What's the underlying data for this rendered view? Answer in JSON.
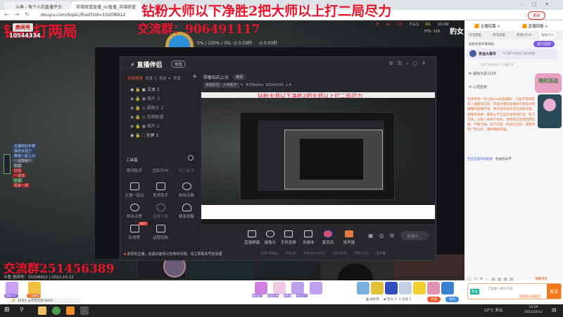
{
  "browser": {
    "tabs": [
      "斗鱼 - 每个人的直播平台",
      "英雄联盟直播_lol直播_英雄联盟"
    ],
    "url": "douyu.com/topic/lhsd?rid=10208912",
    "update_label": "更新"
  },
  "overlay": {
    "banner": "钻粉大师以下净胜2把大师以上打二局尽力",
    "group_top": "交流群：906491117",
    "left_text": "钻粉打两局",
    "room_badge": "房间号",
    "room_id": "10544334",
    "group_bottom": "交流群251456389",
    "room_info": "斗鱼 房间号：10208912 | 2022.10.12",
    "watermark": "豹女"
  },
  "hud": {
    "stats": "0% / 100% / 0%",
    "cd1": "0.59秒",
    "cd2": "0.00秒",
    "score": "8 vs 10",
    "kda": "7/1/1",
    "cs": "81",
    "time": "10:09",
    "fps": "FPS: 158"
  },
  "streamer_app": {
    "logo": "直播伴侣",
    "badge": "体验",
    "scene_tabs": [
      "常用场景",
      "场景 3",
      "场景 4",
      "场景"
    ],
    "sources": [
      "文本 1",
      "图片 3",
      "摄像头 2",
      "英雄联盟",
      "图片 2",
      "全屏 1"
    ],
    "title": "带着钻石上分",
    "edit_label": "修改",
    "category": "英雄联盟 · 大神教学",
    "nickname": "冰华Bekko",
    "room": "10544334",
    "fans": "4",
    "toolbox_title": "工具箱",
    "tool_row1": [
      "歌词助手",
      "全民乐PK",
      "大力金币"
    ],
    "tools": [
      "主播一起玩",
      "发货助手",
      "粉丝点歌",
      "粉丝点赞",
      "投屏下载",
      "健康提醒",
      "礼物秀",
      "远程控制"
    ],
    "hot_badge": "HOT",
    "notice": "亲爱的主播，如遇设备报公告到的问题，请立即联系号前说服",
    "bottom_buttons": [
      "直播屏幕",
      "摄像头",
      "手机投屏",
      "多媒体",
      "麦克风",
      "扬声器"
    ],
    "start_label": "直播中...",
    "status": [
      "码率:5Mb/s",
      "FPS:60",
      "丢帧:0(0.00%)",
      "CPU:44%",
      "内存:57%",
      "未开播"
    ]
  },
  "sidebar": {
    "links": [
      "主播招募 >",
      "直播回看 >"
    ],
    "tabs": [
      "日活跃度",
      "周活跃度",
      "贵宾(914)",
      "钻粉(53)"
    ],
    "rank_title": "钻粉享受专属特权",
    "join_label": "成为钻粉",
    "event_title": "幸运大事件",
    "event_text": "今日第1位粉丝已成为钻粉",
    "hint": "斗鱼严禁未成年人大额打赏",
    "items": [
      "超级元素1028",
      "心愿签到"
    ],
    "notice": "欢迎来到一爷之猫ovo的直播间。斗鱼严禁未成年人直播或打赏，欢迎主播在直播间内营造绿色健康的直播环境。请勿发布任何违法违规内容，请理性消费，警惕以不正当方式诱导打赏、私下交易，以防人身财产损失。请勿轻信各类招聘征婚、代练代抽、私下交易、购买礼包码、游戏币等广告信息，谨防网络诈骗。",
    "last_msg": "百合花盛开的如意",
    "last_msg2": "豹女的头不",
    "promo": "限时活动"
  },
  "chat_input": {
    "placeholder": "这里输入聊天内容",
    "send": "发送",
    "badge": "粉丝",
    "mode": "弹幕特效",
    "tag": "欢迎加入粉丝团"
  },
  "gift_bar": {
    "left_items": [
      "超级大厅",
      "三连抽奖"
    ],
    "right_items": [
      "福利盒子",
      "超级召唤",
      "造梦者",
      "钻石大厅"
    ],
    "coupon": "福利券",
    "fish_ball": "鱼丸 0",
    "fish_wing": "鱼翅 0",
    "recharge": "充值",
    "bag": "背包",
    "ticker": "【5条】@可可吃肉-8450"
  },
  "chat_overlay": [
    "主播你好牛啊",
    "操作太强了",
    "带我一起上分",
    "一波再两个",
    "稳健",
    "好强",
    "一波流",
    "牛逼",
    "再来一把"
  ],
  "taskbar": {
    "weather": "22°C 多云",
    "time": "14:29",
    "date": "2022/10/12"
  }
}
